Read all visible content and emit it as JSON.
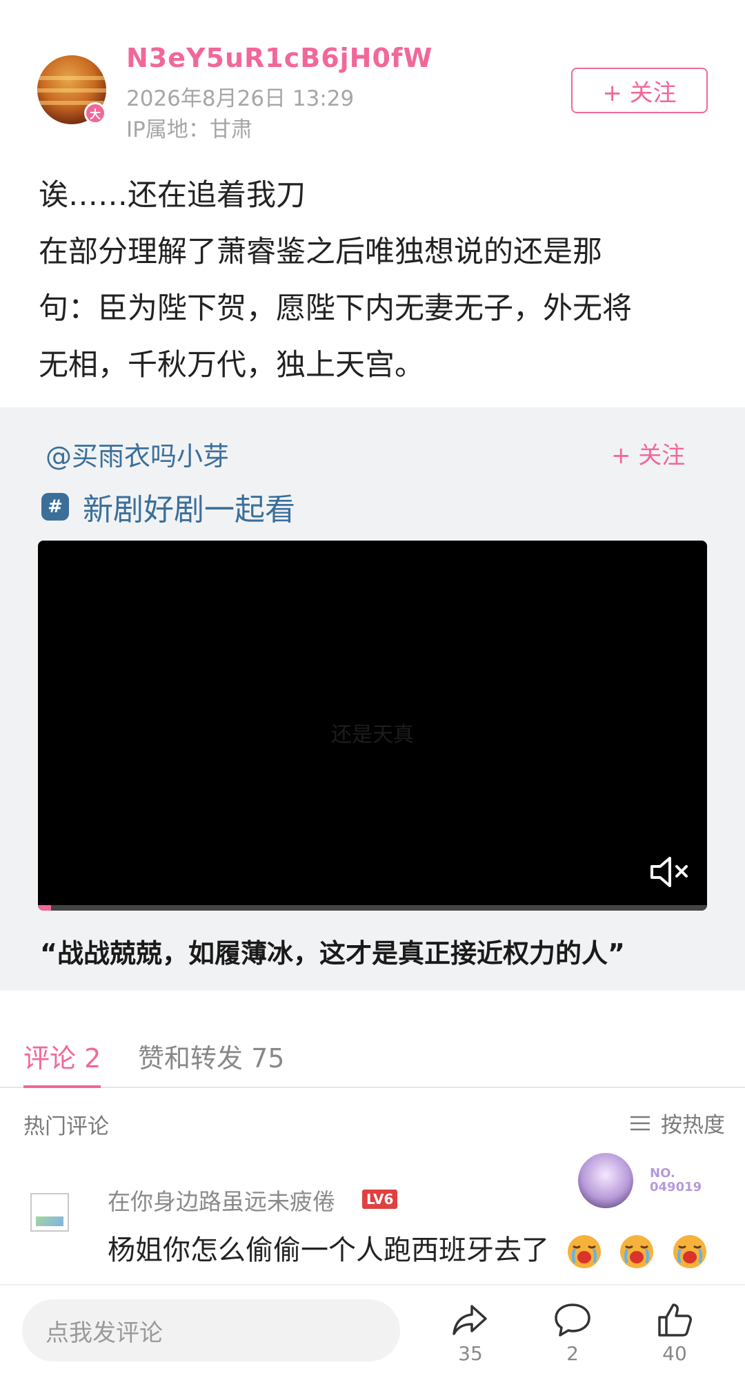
{
  "post": {
    "username": "N3eY5uR1cB6jH0fW",
    "avatar_badge": "大",
    "time": "2026年8月26日 13:29",
    "ip_location": "IP属地：甘肃",
    "follow_label": "+ 关注",
    "text": "诶……还在追着我刀\n在部分理解了萧睿鉴之后唯独想说的还是那\n句：臣为陛下贺，愿陛下内无妻无子，外无将\n无相，千秋万代，独上天宫。"
  },
  "repost": {
    "author": "@买雨衣吗小芽",
    "follow_label": "+ 关注",
    "topic_icon": "#",
    "topic": "新剧好剧一起看",
    "video_caption": "还是天真",
    "video_progress": 0.02,
    "video_title": "“战战兢兢，如履薄冰，这才是真正接近权力的人”"
  },
  "tabs": {
    "comments": "评论 2",
    "likes_reposts": "赞和转发 75"
  },
  "comments_section": {
    "hot_label": "热门评论",
    "sort_label": "按热度"
  },
  "comment": {
    "user": "在你身边路虽远未疲倦",
    "level": "LV6",
    "text": "杨姐你怎么偷偷一个人跑西班牙去了",
    "sticker_no": "NO.\n049019"
  },
  "bottom_bar": {
    "input_placeholder": "点我发评论",
    "repost_count": "35",
    "comment_count": "2",
    "like_count": "40"
  },
  "colors": {
    "accent": "#f2679a",
    "link": "#3b6f9a",
    "repost_bg": "#f1f2f4"
  }
}
